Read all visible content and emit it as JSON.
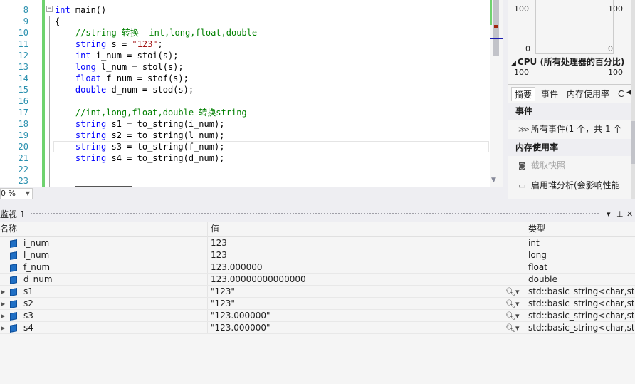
{
  "editor": {
    "line_numbers": [
      "8",
      "9",
      "10",
      "11",
      "12",
      "13",
      "14",
      "15",
      "16",
      "17",
      "18",
      "19",
      "20",
      "21",
      "22",
      "23"
    ],
    "lines": [
      [
        {
          "t": "int",
          "c": "kw"
        },
        {
          "t": " main()",
          "c": ""
        }
      ],
      [
        {
          "t": "{",
          "c": ""
        }
      ],
      [
        {
          "t": "    //string 转换  int,long,float,double",
          "c": "cm"
        }
      ],
      [
        {
          "t": "    ",
          "c": ""
        },
        {
          "t": "string",
          "c": "kw"
        },
        {
          "t": " s = ",
          "c": ""
        },
        {
          "t": "\"123\"",
          "c": "st"
        },
        {
          "t": ";",
          "c": ""
        }
      ],
      [
        {
          "t": "    ",
          "c": ""
        },
        {
          "t": "int",
          "c": "kw"
        },
        {
          "t": " i_num = stoi(s);",
          "c": ""
        }
      ],
      [
        {
          "t": "    ",
          "c": ""
        },
        {
          "t": "long",
          "c": "kw"
        },
        {
          "t": " l_num = stol(s);",
          "c": ""
        }
      ],
      [
        {
          "t": "    ",
          "c": ""
        },
        {
          "t": "float",
          "c": "kw"
        },
        {
          "t": " f_num = stof(s);",
          "c": ""
        }
      ],
      [
        {
          "t": "    ",
          "c": ""
        },
        {
          "t": "double",
          "c": "kw"
        },
        {
          "t": " d_num = stod(s);",
          "c": ""
        }
      ],
      [
        {
          "t": "",
          "c": ""
        }
      ],
      [
        {
          "t": "    //int,long,float,double 转换string",
          "c": "cm"
        }
      ],
      [
        {
          "t": "    ",
          "c": ""
        },
        {
          "t": "string",
          "c": "kw"
        },
        {
          "t": " s1 = to_string(i_num);",
          "c": ""
        }
      ],
      [
        {
          "t": "    ",
          "c": ""
        },
        {
          "t": "string",
          "c": "kw"
        },
        {
          "t": " s2 = to_string(l_num);",
          "c": ""
        }
      ],
      [
        {
          "t": "    ",
          "c": ""
        },
        {
          "t": "string",
          "c": "kw"
        },
        {
          "t": " s3 = to_string(f_num);",
          "c": ""
        }
      ],
      [
        {
          "t": "    ",
          "c": ""
        },
        {
          "t": "string",
          "c": "kw"
        },
        {
          "t": " s4 = to_string(d_num);",
          "c": ""
        }
      ],
      [
        {
          "t": "",
          "c": ""
        }
      ],
      [
        {
          "t": "",
          "c": ""
        }
      ]
    ],
    "zoom": "0 %",
    "fold_symbol": "−"
  },
  "diagnostics": {
    "graph_left_top": "100",
    "graph_left_bottom": "0",
    "graph_right_top": "100",
    "graph_right_bottom": "0",
    "cpu_title": "CPU (所有处理器的百分比)",
    "cpu_left_top": "100",
    "cpu_right_top": "100",
    "tabs": [
      "摘要",
      "事件",
      "内存使用率",
      "C"
    ],
    "section_events": "事件",
    "events_item": "所有事件(1 个，共 1 个",
    "section_memory": "内存使用率",
    "memory_item_1": "截取快照",
    "memory_item_2": "启用堆分析(会影响性能"
  },
  "watch": {
    "title": "监视 1",
    "columns": {
      "name": "名称",
      "value": "值",
      "type": "类型"
    },
    "rows": [
      {
        "name": "i_num",
        "value": "123",
        "type": "int",
        "expandable": false
      },
      {
        "name": "l_num",
        "value": "123",
        "type": "long",
        "expandable": false
      },
      {
        "name": "f_num",
        "value": "123.000000",
        "type": "float",
        "expandable": false
      },
      {
        "name": "d_num",
        "value": "123.00000000000000",
        "type": "double",
        "expandable": false
      },
      {
        "name": "s1",
        "value": "\"123\"",
        "type": "std::basic_string<char,std...",
        "expandable": true
      },
      {
        "name": "s2",
        "value": "\"123\"",
        "type": "std::basic_string<char,std...",
        "expandable": true
      },
      {
        "name": "s3",
        "value": "\"123.000000\"",
        "type": "std::basic_string<char,std...",
        "expandable": true
      },
      {
        "name": "s4",
        "value": "\"123.000000\"",
        "type": "std::basic_string<char,std...",
        "expandable": true
      }
    ]
  },
  "colors": {
    "keyword": "#0000ff",
    "comment": "#008000",
    "string": "#a31515",
    "line_number": "#2b91af",
    "change_bar": "#6fd26f"
  }
}
